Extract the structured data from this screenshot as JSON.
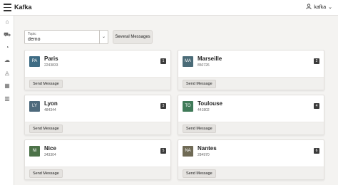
{
  "app": {
    "title": "Kafka"
  },
  "user": {
    "name": "kafka"
  },
  "sidenav": [
    {
      "icon": "home-icon",
      "glyph": "⌂"
    },
    {
      "icon": "cart-icon",
      "glyph": "⛟"
    },
    {
      "icon": "rss-icon",
      "glyph": "◔"
    },
    {
      "icon": "cloud-icon",
      "glyph": "☁"
    },
    {
      "icon": "chart-icon",
      "glyph": "◬"
    },
    {
      "icon": "grid-icon",
      "glyph": "▦"
    },
    {
      "icon": "barcode-icon",
      "glyph": "▥"
    }
  ],
  "topic": {
    "label": "Topic",
    "value": "demo"
  },
  "several_label": "Several Messages",
  "send_label": "Send Message",
  "cards": [
    {
      "initials": "PA",
      "city": "Paris",
      "code": "2243833",
      "badge": "1",
      "color": "#3f6c84"
    },
    {
      "initials": "MA",
      "city": "Marseille",
      "code": "850726",
      "badge": "2",
      "color": "#4a6b77"
    },
    {
      "initials": "LY",
      "city": "Lyon",
      "code": "484344",
      "badge": "3",
      "color": "#4e6a7c"
    },
    {
      "initials": "TO",
      "city": "Toulouse",
      "code": "441802",
      "badge": "4",
      "color": "#3f7a58"
    },
    {
      "initials": "NI",
      "city": "Nice",
      "code": "343304",
      "badge": "5",
      "color": "#4c7248"
    },
    {
      "initials": "NA",
      "city": "Nantes",
      "code": "284970",
      "badge": "6",
      "color": "#6f6a55"
    }
  ]
}
